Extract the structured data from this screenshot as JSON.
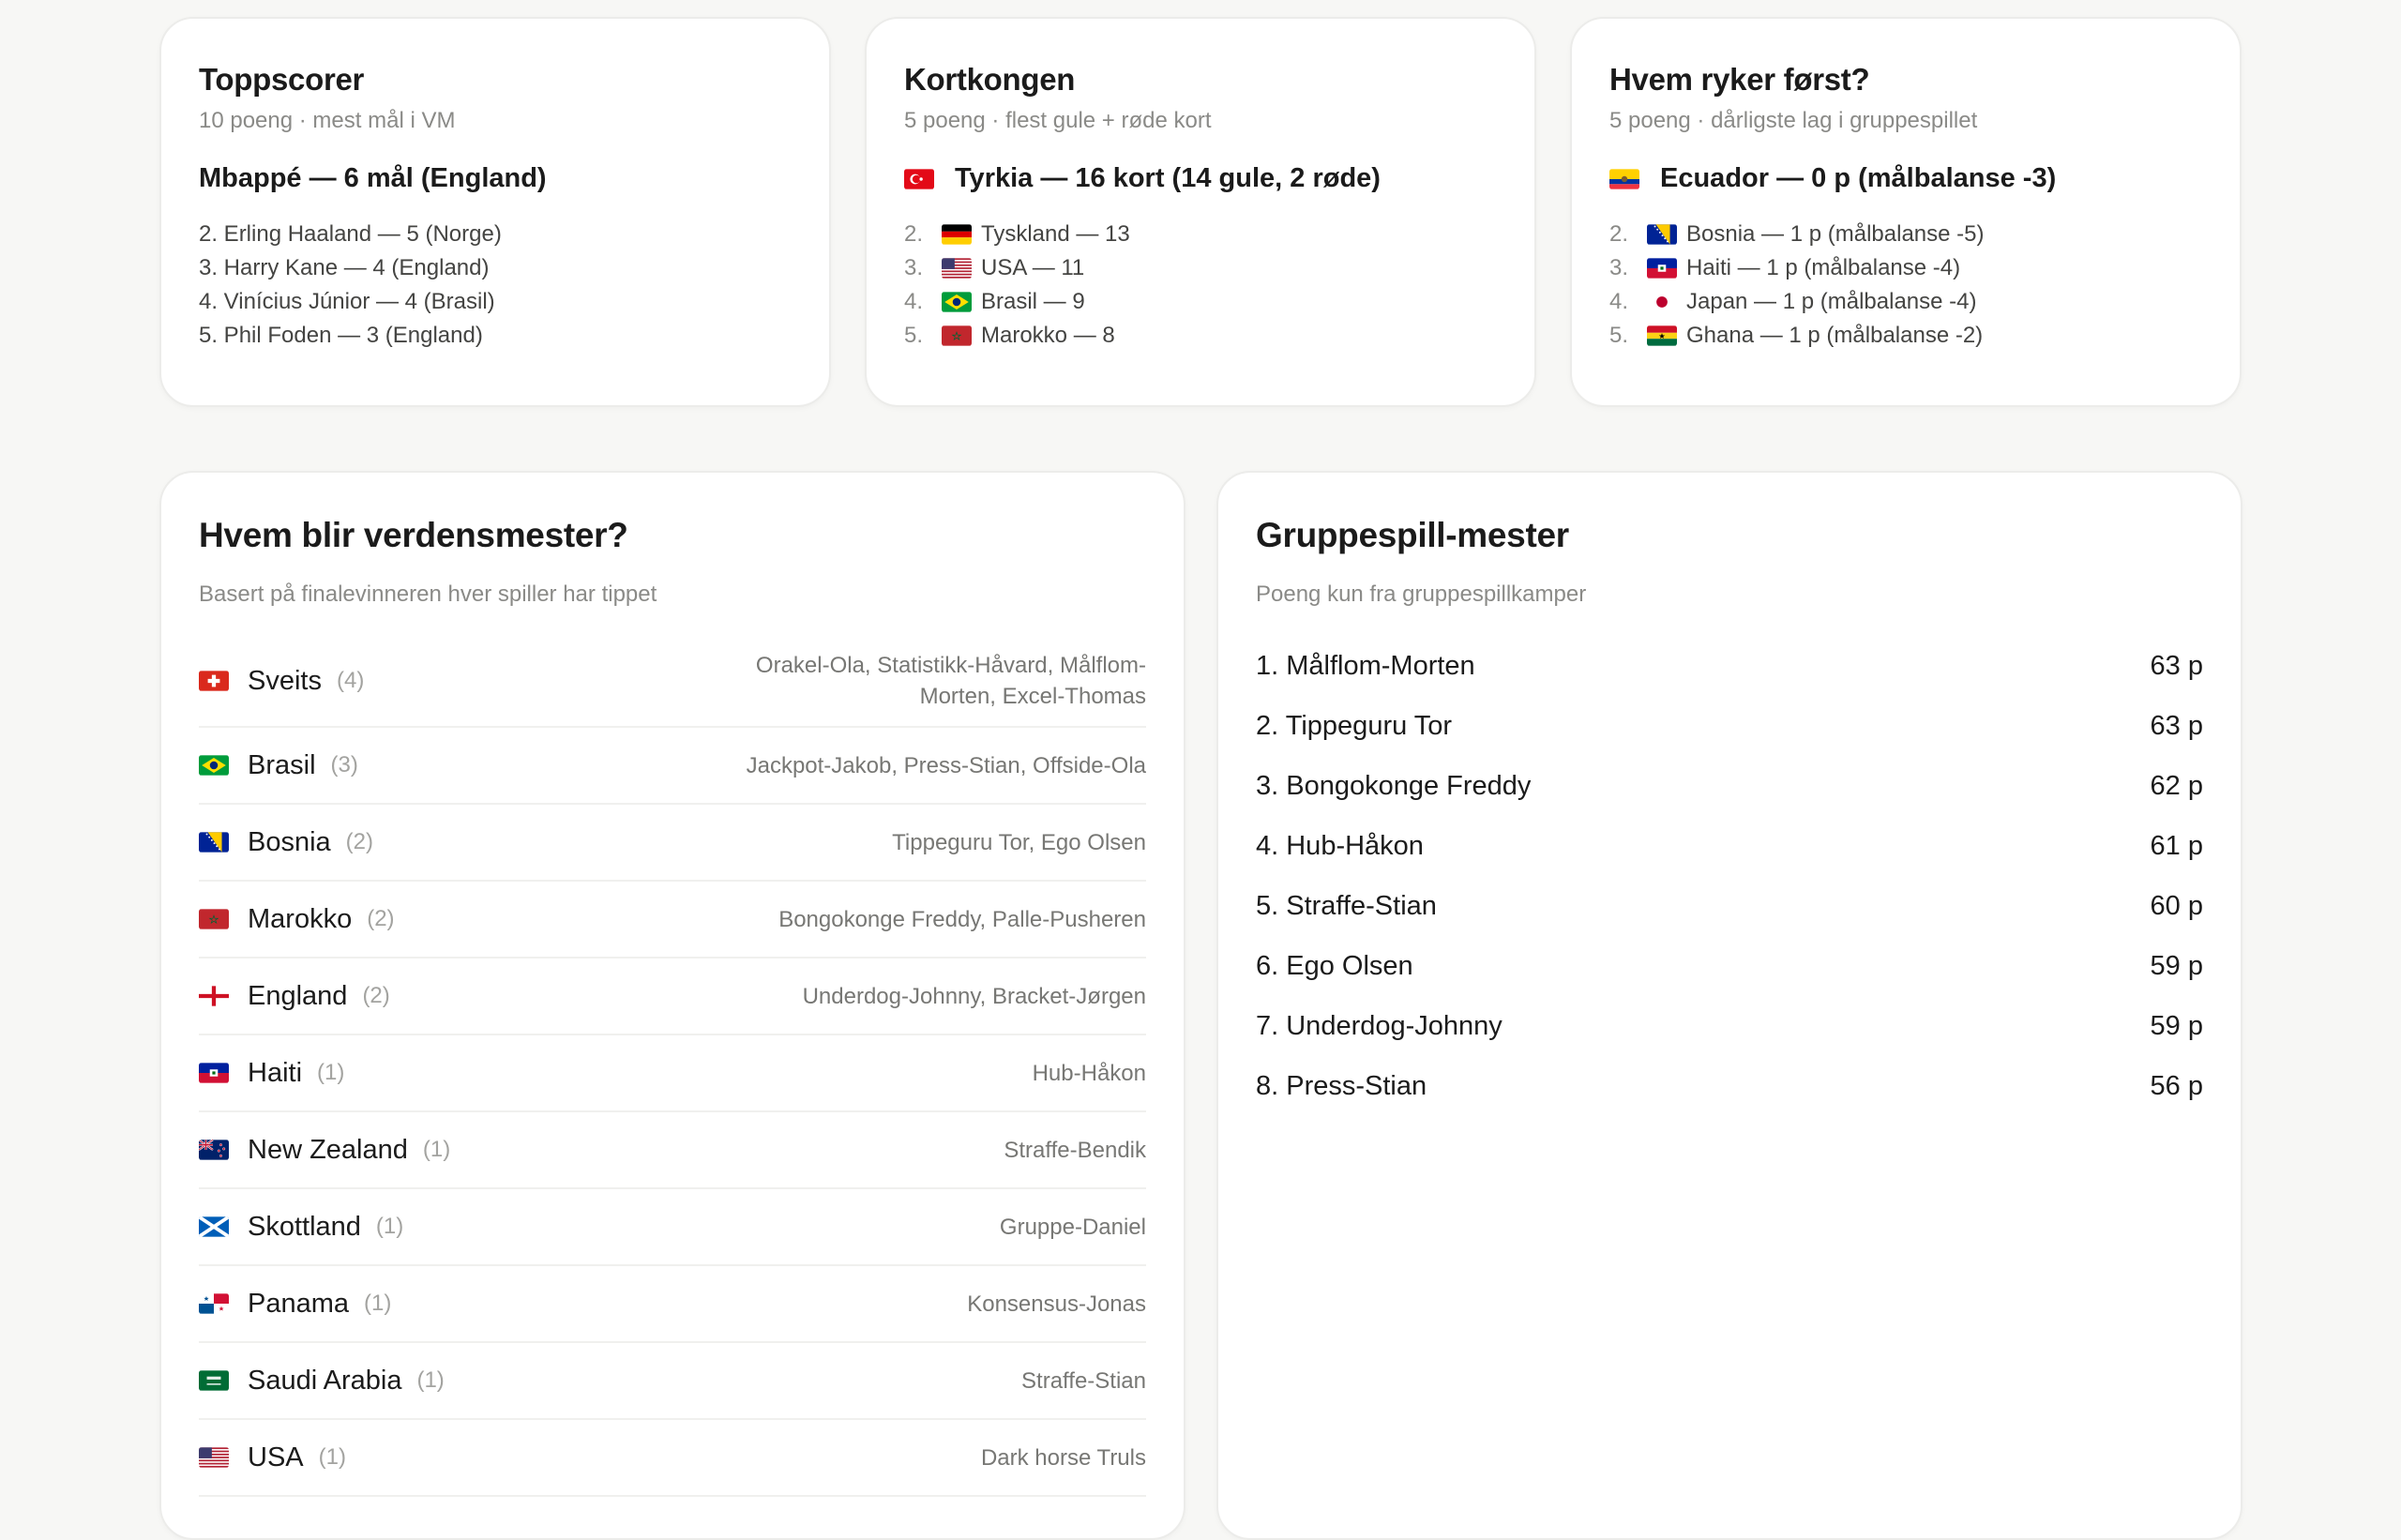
{
  "top_scorer": {
    "title": "Toppscorer",
    "subtitle": "10 poeng · mest mål i VM",
    "leader": "Mbappé — 6 mål (England)",
    "rest": [
      "2. Erling Haaland — 5 (Norge)",
      "3. Harry Kane — 4 (England)",
      "4. Vinícius Júnior — 4 (Brasil)",
      "5. Phil Foden — 3 (England)"
    ]
  },
  "card_king": {
    "title": "Kortkongen",
    "subtitle": "5 poeng · flest gule + røde kort",
    "leader": "Tyrkia — 16 kort (14 gule, 2 røde)",
    "rest": [
      {
        "num": "2.",
        "text": "Tyskland — 13",
        "flag": "germany"
      },
      {
        "num": "3.",
        "text": "USA — 11",
        "flag": "usa"
      },
      {
        "num": "4.",
        "text": "Brasil — 9",
        "flag": "brazil"
      },
      {
        "num": "5.",
        "text": "Marokko — 8",
        "flag": "morocco"
      }
    ]
  },
  "first_out": {
    "title": "Hvem ryker først?",
    "subtitle": "5 poeng · dårligste lag i gruppespillet",
    "leader": "Ecuador — 0 p (målbalanse -3)",
    "rest": [
      {
        "num": "2.",
        "text": "Bosnia — 1 p (målbalanse -5)",
        "flag": "bosnia"
      },
      {
        "num": "3.",
        "text": "Haiti — 1 p (målbalanse -4)",
        "flag": "haiti"
      },
      {
        "num": "4.",
        "text": "Japan — 1 p (målbalanse -4)",
        "flag": "japan"
      },
      {
        "num": "5.",
        "text": "Ghana — 1 p (målbalanse -2)",
        "flag": "ghana"
      }
    ]
  },
  "champion": {
    "title": "Hvem blir verdensmester?",
    "subtitle": "Basert på finalevinneren hver spiller har tippet",
    "rows": [
      {
        "country": "Sveits",
        "count": "(4)",
        "players": "Orakel-Ola, Statistikk-Håvard, Målflom-Morten, Excel-Thomas",
        "flag": "switzerland"
      },
      {
        "country": "Brasil",
        "count": "(3)",
        "players": "Jackpot-Jakob, Press-Stian, Offside-Ola",
        "flag": "brazil"
      },
      {
        "country": "Bosnia",
        "count": "(2)",
        "players": "Tippeguru Tor, Ego Olsen",
        "flag": "bosnia"
      },
      {
        "country": "Marokko",
        "count": "(2)",
        "players": "Bongokonge Freddy, Palle-Pusheren",
        "flag": "morocco"
      },
      {
        "country": "England",
        "count": "(2)",
        "players": "Underdog-Johnny, Bracket-Jørgen",
        "flag": "england"
      },
      {
        "country": "Haiti",
        "count": "(1)",
        "players": "Hub-Håkon",
        "flag": "haiti"
      },
      {
        "country": "New Zealand",
        "count": "(1)",
        "players": "Straffe-Bendik",
        "flag": "newzealand"
      },
      {
        "country": "Skottland",
        "count": "(1)",
        "players": "Gruppe-Daniel",
        "flag": "scotland"
      },
      {
        "country": "Panama",
        "count": "(1)",
        "players": "Konsensus-Jonas",
        "flag": "panama"
      },
      {
        "country": "Saudi Arabia",
        "count": "(1)",
        "players": "Straffe-Stian",
        "flag": "saudi"
      },
      {
        "country": "USA",
        "count": "(1)",
        "players": "Dark horse Truls",
        "flag": "usa"
      }
    ]
  },
  "group_master": {
    "title": "Gruppespill-mester",
    "subtitle": "Poeng kun fra gruppespillkamper",
    "rows": [
      {
        "name": "1. Målflom-Morten",
        "points": "63 p"
      },
      {
        "name": "2. Tippeguru Tor",
        "points": "63 p"
      },
      {
        "name": "3. Bongokonge Freddy",
        "points": "62 p"
      },
      {
        "name": "4. Hub-Håkon",
        "points": "61 p"
      },
      {
        "name": "5. Straffe-Stian",
        "points": "60 p"
      },
      {
        "name": "6. Ego Olsen",
        "points": "59 p"
      },
      {
        "name": "7. Underdog-Johnny",
        "points": "59 p"
      },
      {
        "name": "8. Press-Stian",
        "points": "56 p"
      }
    ]
  }
}
